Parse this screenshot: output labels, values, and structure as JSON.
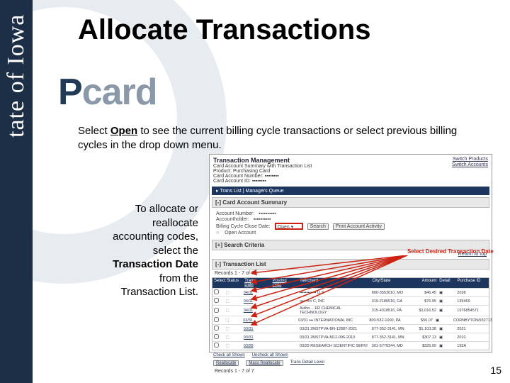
{
  "tab_text": "tate of Iowa",
  "logo": {
    "p": "P",
    "rest": "card"
  },
  "title": "Allocate Transactions",
  "instruction": {
    "pre": "Select ",
    "open": "Open",
    "post": " to see the current billing cycle transactions or select previous billing cycles in the drop down menu."
  },
  "callout": {
    "l1": "To allocate or",
    "l2": "reallocate",
    "l3": "accounting codes,",
    "l4": "select the",
    "l5": "Transaction Date",
    "l6": "from the",
    "l7": "Transaction List."
  },
  "screenshot": {
    "header": {
      "title": "Transaction Management",
      "subtitle": "Card Account Summary with Transaction List",
      "link1": "Switch Products",
      "link2": "Switch Accounts"
    },
    "navbar": "▸ Trans List | Managers Queue",
    "section_card": "[-] Card Account Summary",
    "fields": {
      "account_number": "Account Number:",
      "accountholder": "Accountholder:",
      "close_label": "Billing Cycle Close Date:",
      "open_value": "Open    ▾",
      "search_btn": "Search",
      "print_btn": "Print Account Activity",
      "open_account": "Open Account"
    },
    "section_search": "[+] Search Criteria",
    "section_tlist_h": "[-] Transaction List",
    "records": "Records 1 - 7 of 7",
    "thead": {
      "chk": "Select",
      "status": "Status",
      "trans": "Trans",
      "date": "Date",
      "posting": "Posting",
      "merchant": "Merchant",
      "citystate": "City/State",
      "amount": "Amount",
      "detail": "Detail",
      "purchase": "Purchase ID"
    },
    "rows": [
      {
        "date": "04/11",
        "merchant": "▪▪▪▪▪▪▪▪▪▪▪▪ LLS",
        "city": "800-3553010, MO",
        "amount": "$46.45",
        "detail": "▣",
        "pid": "2038"
      },
      {
        "date": "04/11",
        "merchant": "▪▪▪▪▪▪▪▪▪ C, INC",
        "city": "319-2186516, GA",
        "amount": "$76.95",
        "detail": "▣",
        "pid": "139469"
      },
      {
        "date": "04/11",
        "merchant": "Autho… ER CHEMICAL TECHNOLOGY",
        "city": "315-4318516, PA",
        "amount": "$1,016.52",
        "detail": "▣",
        "pid": "1976854571"
      },
      {
        "date": "03/31",
        "merchant": "03/31  ▪▪▪ INTERNATIONAL INC",
        "city": "800-532-1000, PA",
        "amount": "$56.07",
        "detail": "▣",
        "pid": "CORNBYTON/932713"
      },
      {
        "date": "03/31",
        "merchant": "03/31  2MSTPVA-BN-12887-2021",
        "city": "877-352-3141, MN",
        "amount": "$1,103.38",
        "detail": "▣",
        "pid": "2021"
      },
      {
        "date": "03/31",
        "merchant": "03/31  2MSTPVA-M12-096-2010",
        "city": "877-352-3141, MN",
        "amount": "$307.13",
        "detail": "▣",
        "pid": "2010"
      },
      {
        "date": "03/29",
        "merchant": "03/29  RESEARCH SCIENTIFIC SERVI",
        "city": "301-5770344, MD",
        "amount": "$325.00",
        "detail": "▣",
        "pid": "193A"
      }
    ],
    "footer": {
      "check_all": "Check all Shown",
      "uncheck_all": "Uncheck all Shown",
      "realloc": "Reallocate",
      "mass": "Mass Reallocate",
      "trans_detail": "Trans Detail Level"
    },
    "callout2": "Select Desired Transaction Date"
  },
  "pagenum": "15"
}
